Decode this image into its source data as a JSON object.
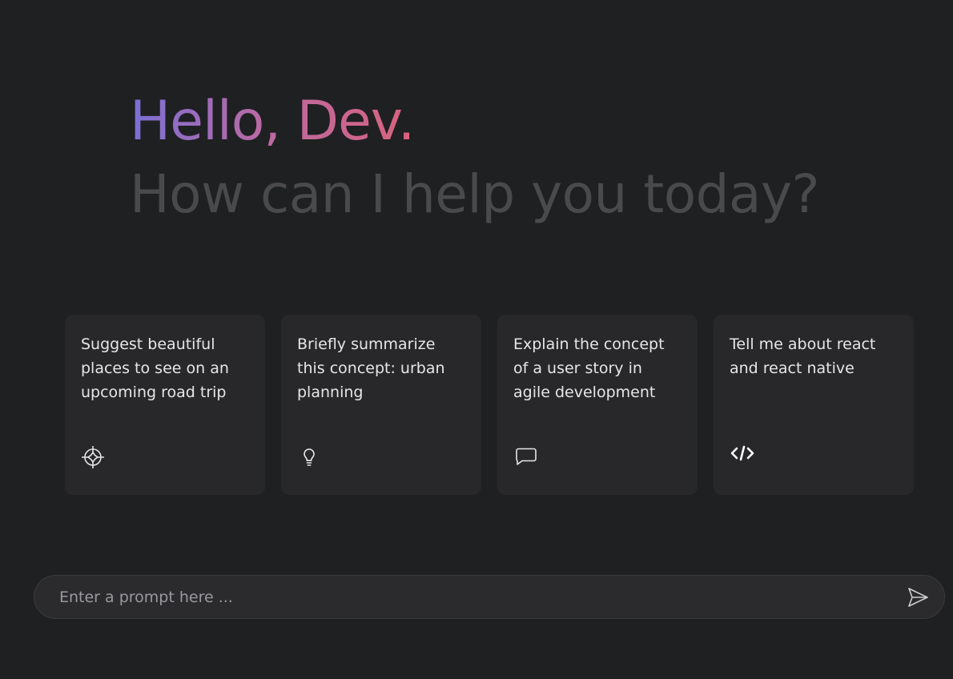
{
  "header": {
    "greeting": "Hello, Dev.",
    "subtitle": "How can I help you today?"
  },
  "cards": [
    {
      "text": "Suggest beautiful places to see on an upcoming road trip",
      "icon": "compass-icon"
    },
    {
      "text": "Briefly summarize this concept: urban planning",
      "icon": "lightbulb-icon"
    },
    {
      "text": "Explain the concept of a user story in agile development",
      "icon": "chat-bubble-icon"
    },
    {
      "text": "Tell me about react and react native",
      "icon": "code-icon"
    }
  ],
  "prompt": {
    "placeholder": "Enter a prompt here ...",
    "value": "",
    "send_icon": "send-icon"
  },
  "colors": {
    "background": "#1f2022",
    "card": "#28282a",
    "gradient_start": "#7a6fd6",
    "gradient_end": "#d9627d",
    "subtitle": "#4a4a4c"
  }
}
